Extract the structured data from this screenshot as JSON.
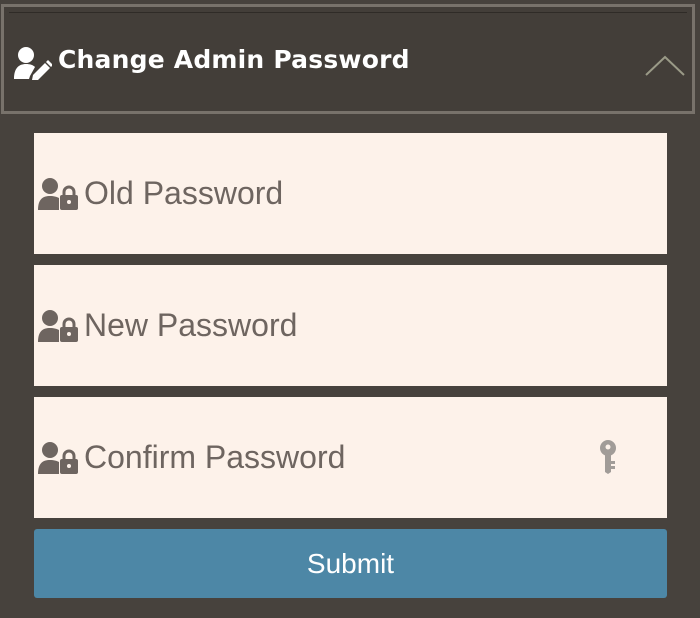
{
  "header": {
    "title": "Change Admin Password",
    "icon": "user-edit-icon",
    "toggle_icon": "chevron-up-icon"
  },
  "form": {
    "fields": [
      {
        "placeholder": "Old Password",
        "icon": "user-lock-icon"
      },
      {
        "placeholder": "New Password",
        "icon": "user-lock-icon"
      },
      {
        "placeholder": "Confirm Password",
        "icon": "user-lock-icon",
        "trailing_icon": "key-icon"
      }
    ],
    "submit_label": "Submit"
  },
  "colors": {
    "background": "#47423d",
    "header_border": "#78726b",
    "field_background": "#fdf2ea",
    "text_muted": "#6e6560",
    "submit_button": "#4d87a6"
  }
}
